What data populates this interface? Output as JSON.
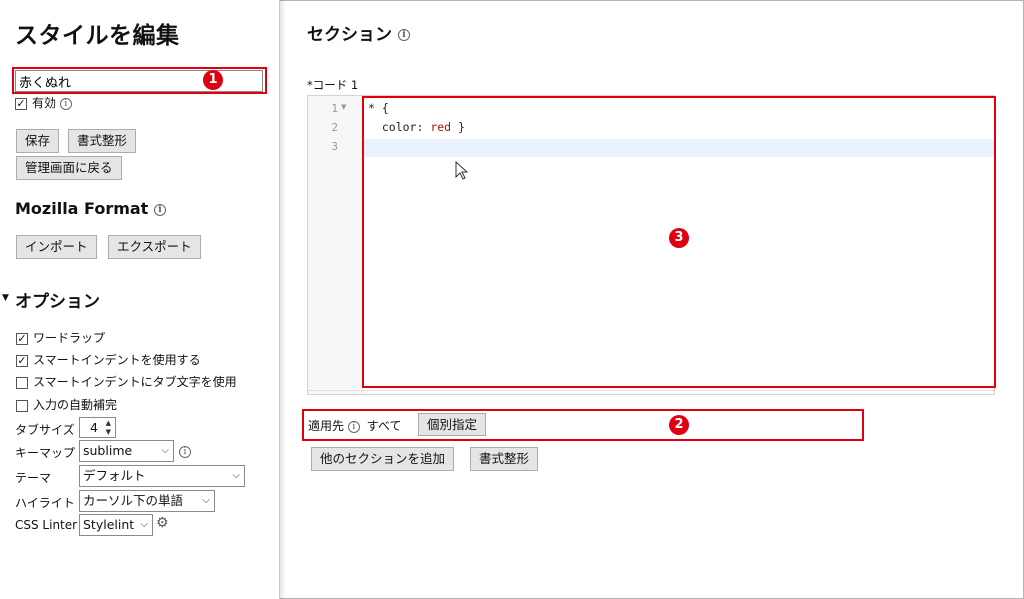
{
  "sidebar": {
    "title": "スタイルを編集",
    "style_name_value": "赤くぬれ",
    "enabled_label": "有効",
    "enabled_checked": true,
    "save_label": "保存",
    "format_label": "書式整形",
    "back_label": "管理画面に戻る",
    "mozilla_title": "Mozilla Format",
    "import_label": "インポート",
    "export_label": "エクスポート",
    "options_title": "オプション",
    "options": [
      {
        "label": "ワードラップ",
        "checked": true
      },
      {
        "label": "スマートインデントを使用する",
        "checked": true
      },
      {
        "label": "スマートインデントにタブ文字を使用",
        "checked": false
      },
      {
        "label": "入力の自動補完",
        "checked": false
      }
    ],
    "tab_size_label": "タブサイズ",
    "tab_size_value": "4",
    "keymap_label": "キーマップ",
    "keymap_value": "sublime",
    "theme_label": "テーマ",
    "theme_value": "デフォルト",
    "highlight_label": "ハイライト",
    "highlight_value": "カーソル下の単語",
    "linter_label": "CSS Linter",
    "linter_value": "Stylelint"
  },
  "main": {
    "section_title": "セクション",
    "code_label": "*コード 1",
    "line_numbers": [
      "1",
      "2",
      "3"
    ],
    "code_lines": {
      "l1": "* {",
      "l2_prop": "  color: ",
      "l2_val": "red",
      "l2_end": " }"
    },
    "applies_to_label": "適用先",
    "applies_to_value": "すべて",
    "specify_label": "個別指定",
    "add_section_label": "他のセクションを追加",
    "format_label": "書式整形"
  },
  "annotations": {
    "badge1": "1",
    "badge2": "2",
    "badge3": "3"
  },
  "colors": {
    "annotation_red": "#e1000f",
    "active_line": "#e9f2fd",
    "code_value_color": "#aa1111"
  }
}
